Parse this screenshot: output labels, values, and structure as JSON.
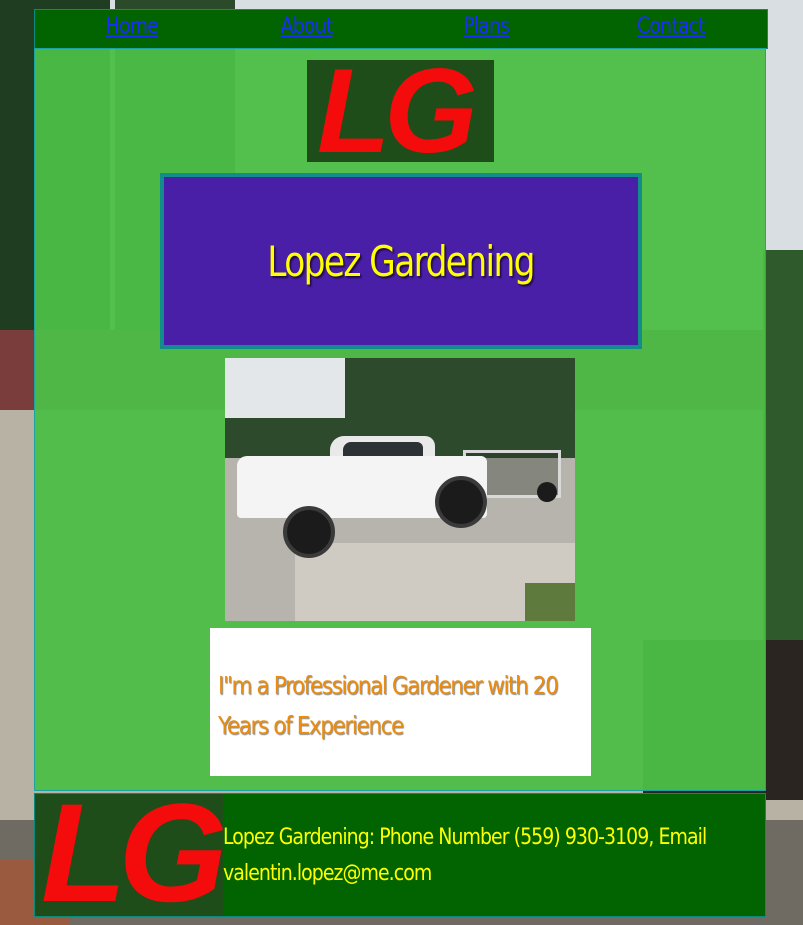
{
  "nav": {
    "items": [
      {
        "label": "Home"
      },
      {
        "label": "About"
      },
      {
        "label": "Plans"
      },
      {
        "label": "Contact"
      }
    ]
  },
  "logo": {
    "text": "LG"
  },
  "hero": {
    "title": "Lopez Gardening"
  },
  "blurb": {
    "text": "I\"m a Professional Gardener with 20 Years of Experience"
  },
  "footer": {
    "text": "Lopez Gardening: Phone Number (559) 930-3109, Email valentin.lopez@me.com"
  },
  "colors": {
    "nav_bg": "#016400",
    "panel_bg": "#4cbe46",
    "title_box_bg": "#4a1fa8",
    "title_text": "#ffff00",
    "blurb_text": "#ea8d0f",
    "logo_text": "#f40b0b",
    "link": "#1b2cff"
  }
}
